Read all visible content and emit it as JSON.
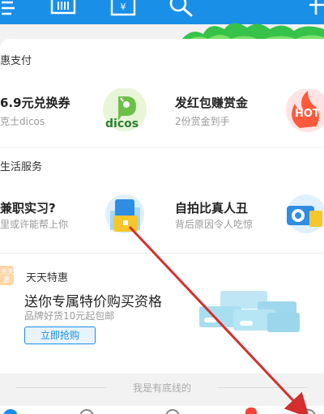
{
  "topbar": {
    "icons": [
      "scan-icon",
      "barcode-pay-icon",
      "receipt-yuan-icon",
      "search-icon",
      "plus-icon"
    ]
  },
  "section_pay": {
    "title": "惠支付"
  },
  "pay_items": [
    {
      "title": "6.9元兑换券",
      "sub": "克士dicos",
      "logo_text": "dicos"
    },
    {
      "title": "发红包赚赏金",
      "sub": "2份赏金到手",
      "logo_text": "HOT"
    }
  ],
  "section_life": {
    "title": "生活服务"
  },
  "life_items": [
    {
      "title": "兼职实习?",
      "sub": "里或许能帮上你"
    },
    {
      "title": "自拍比真人丑",
      "sub": "背后原因令人吃惊"
    }
  ],
  "promo": {
    "badge": "天天",
    "badge2": "惠",
    "label": "天天特惠",
    "title": "送你专属特价购买资格",
    "sub": "品牌好货10元起包邮",
    "button": "立即抢购"
  },
  "footer": {
    "note": "我是有底线的"
  },
  "colors": {
    "primary": "#1a8fe8",
    "annotation": "#d32f2f"
  }
}
